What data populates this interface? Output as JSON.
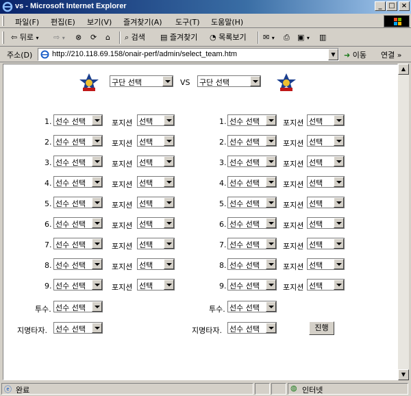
{
  "window": {
    "title": "vs - Microsoft Internet Explorer"
  },
  "menu": {
    "items": [
      "파일(F)",
      "편집(E)",
      "보기(V)",
      "즐겨찾기(A)",
      "도구(T)",
      "도움말(H)"
    ]
  },
  "toolbar": {
    "back": "뒤로",
    "search": "검색",
    "favorites": "즐겨찾기",
    "history": "목록보기"
  },
  "address": {
    "label": "주소(D)",
    "url": "http://210.118.69.158/onair-perf/admin/select_team.htm",
    "go": "이동",
    "links": "연결"
  },
  "status": {
    "text": "완료",
    "zone": "인터넷"
  },
  "page": {
    "team_left": "구단 선택",
    "vs": "VS",
    "team_right": "구단 선택",
    "player_placeholder": "선수 선택",
    "position_label": "포지션",
    "position_placeholder": "선택",
    "pitcher_label": "투수.",
    "dh_label": "지명타자.",
    "submit": "진행",
    "numbers": [
      "1.",
      "2.",
      "3.",
      "4.",
      "5.",
      "6.",
      "7.",
      "8.",
      "9."
    ]
  }
}
